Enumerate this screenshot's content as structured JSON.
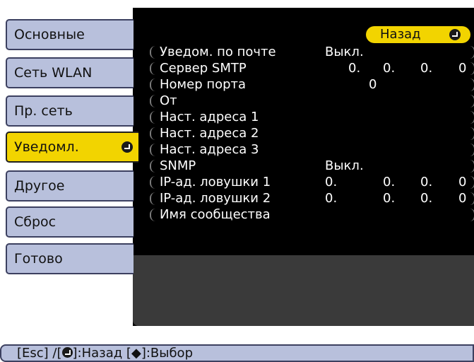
{
  "sidebar": {
    "items": [
      {
        "label": "Основные"
      },
      {
        "label": "Сеть WLAN"
      },
      {
        "label": "Пр. сеть"
      },
      {
        "label": "Уведомл.",
        "active": true
      },
      {
        "label": "Другое"
      },
      {
        "label": "Сброс"
      },
      {
        "label": "Готово"
      }
    ]
  },
  "header": {
    "back_label": "Назад"
  },
  "settings": {
    "rows": [
      {
        "label": "Уведом. по почте",
        "value": "Выкл."
      },
      {
        "label": "Сервер SMTP",
        "ip": [
          "0.",
          "0.",
          "0.",
          "0"
        ]
      },
      {
        "label": "Номер порта",
        "port": "0"
      },
      {
        "label": "От"
      },
      {
        "label": "Наст. адреса 1"
      },
      {
        "label": "Наст. адреса 2"
      },
      {
        "label": "Наст. адреса 3"
      },
      {
        "label": "SNMP",
        "value": "Выкл."
      },
      {
        "label": "IP-ад. ловушки 1",
        "ip": [
          "0.",
          "0.",
          "0.",
          "0"
        ]
      },
      {
        "label": "IP-ад. ловушки 2",
        "ip": [
          "0.",
          "0.",
          "0.",
          "0"
        ]
      },
      {
        "label": "Имя сообщества"
      }
    ]
  },
  "footer": {
    "part1": "[Esc] /[",
    "part2": "]:Назад  [",
    "arrows": "◆",
    "part3": "]:Выбор"
  },
  "icons": [
    "enter-icon",
    "up-down-arrows-icon"
  ],
  "colors": {
    "accent": "#f2d400",
    "panel": "#000000",
    "sidebar_button": "#b8c0dc"
  }
}
